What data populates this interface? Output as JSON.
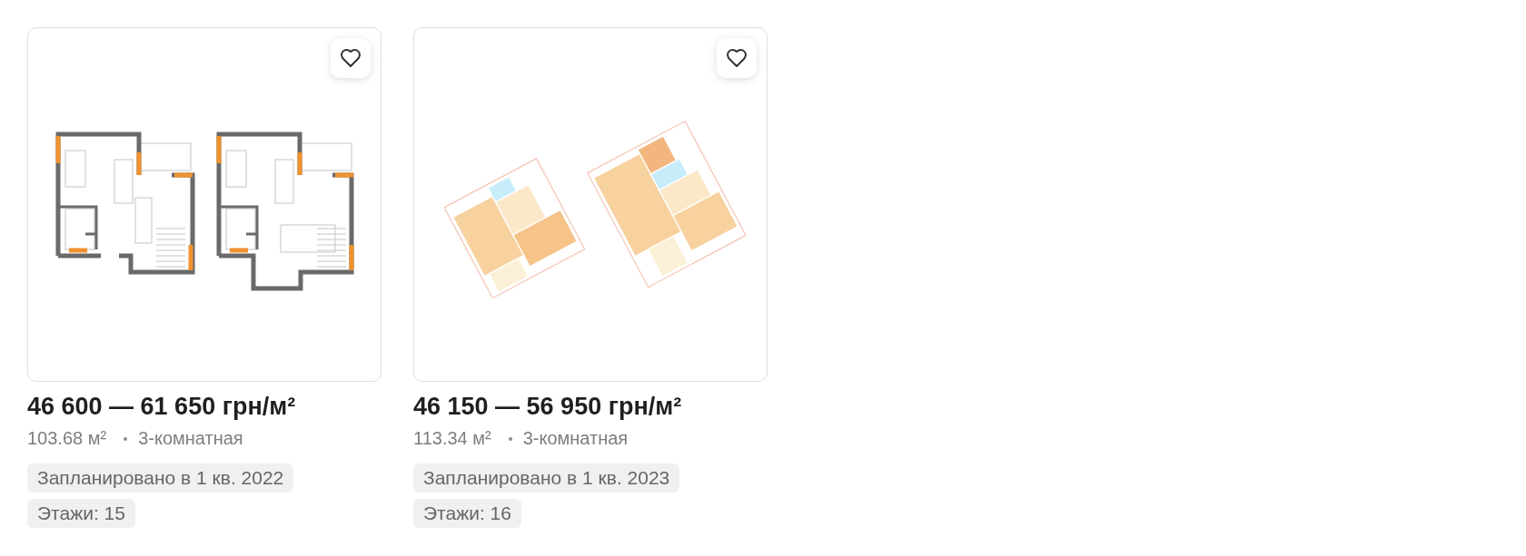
{
  "cards": [
    {
      "favorite": false,
      "floor_plan": {
        "kind": "outline"
      },
      "price": "46 600 — 61 650 грн/м²",
      "area": "103.68 м²",
      "rooms": "3-комнатная",
      "tags": [
        "Запланировано в 1 кв. 2022",
        "Этажи: 15"
      ]
    },
    {
      "favorite": false,
      "floor_plan": {
        "kind": "colored"
      },
      "price": "46 150 — 56 950 грн/м²",
      "area": "113.34 м²",
      "rooms": "3-комнатная",
      "tags": [
        "Запланировано в 1 кв. 2023",
        "Этажи: 16"
      ]
    }
  ]
}
